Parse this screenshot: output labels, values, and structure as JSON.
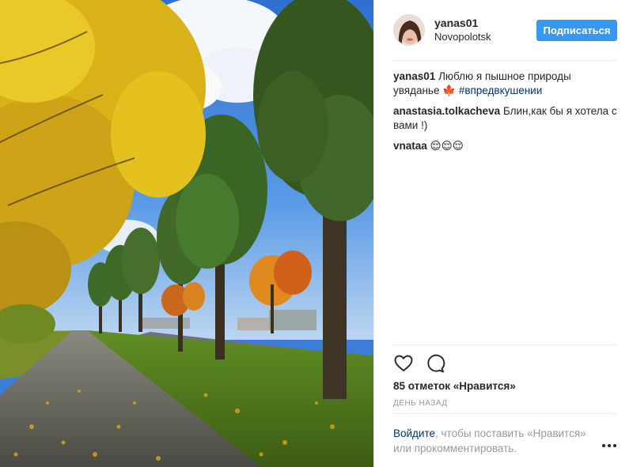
{
  "post": {
    "author": {
      "username": "yanas01",
      "location": "Novopolotsk"
    },
    "follow_label": "Подписаться",
    "caption": {
      "author": "yanas01",
      "text": "Люблю я пышное природы увяданье",
      "emoji": "🍁",
      "hashtag": "#впредвкушении"
    },
    "comments": [
      {
        "author": "anastasia.tolkacheva",
        "text": "Блин,как бы я хотела с вами !)"
      },
      {
        "author": "vnataa",
        "text": "😌😌😌"
      }
    ],
    "likes_text": "85 отметок «Нравится»",
    "timestamp": "день назад",
    "login_prompt": {
      "link": "Войдите",
      "text": ", чтобы поставить «Нравится» или прокомментировать."
    },
    "icons": {
      "like": "heart-icon",
      "comment": "comment-icon",
      "more": "more-options-icon"
    },
    "colors": {
      "follow_button": "#3897f0",
      "link": "#003569",
      "muted": "#999999"
    }
  }
}
